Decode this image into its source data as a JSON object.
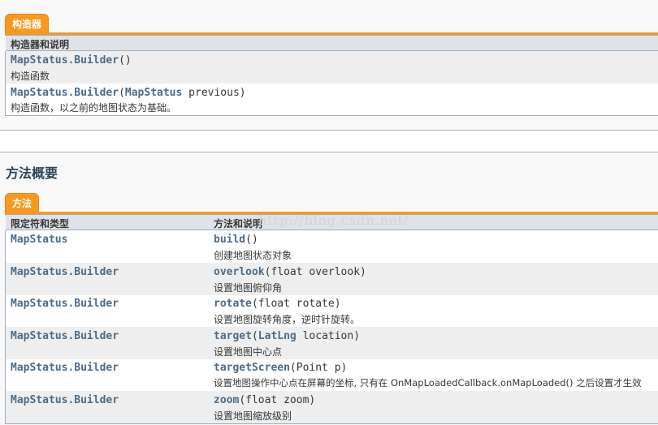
{
  "constructor_section": {
    "tab_label": "构造器",
    "header": "构造器和说明",
    "rows": [
      {
        "link": "MapStatus.Builder",
        "signature_rest": "()",
        "param_link": "",
        "param_rest": "",
        "description": "构造函数"
      },
      {
        "link": "MapStatus.Builder",
        "signature_rest": "(",
        "param_link": "MapStatus",
        "param_rest": " previous)",
        "description": "构造函数，以之前的地图状态为基础。"
      }
    ]
  },
  "method_section": {
    "heading": "方法概要",
    "tab_label": "方法",
    "header_type": "限定符和类型",
    "header_method": "方法和说明",
    "watermark": "http://blog.csdn.net/",
    "rows": [
      {
        "type": "MapStatus",
        "method": "build",
        "params": "()",
        "param_link": "",
        "param_rest": "",
        "description": "创建地图状态对象"
      },
      {
        "type": "MapStatus.Builder",
        "method": "overlook",
        "params": "(float overlook)",
        "param_link": "",
        "param_rest": "",
        "description": "设置地图俯仰角"
      },
      {
        "type": "MapStatus.Builder",
        "method": "rotate",
        "params": "(float rotate)",
        "param_link": "",
        "param_rest": "",
        "description": "设置地图旋转角度，逆时针旋转。"
      },
      {
        "type": "MapStatus.Builder",
        "method": "target",
        "params": "(",
        "param_link": "LatLng",
        "param_rest": " location)",
        "description": "设置地图中心点"
      },
      {
        "type": "MapStatus.Builder",
        "method": "targetScreen",
        "params": "(Point p)",
        "param_link": "",
        "param_rest": "",
        "description": "设置地图操作中心点在屏幕的坐标, 只有在 OnMapLoadedCallback.onMapLoaded() 之后设置才生效"
      },
      {
        "type": "MapStatus.Builder",
        "method": "zoom",
        "params": "(float zoom)",
        "param_link": "",
        "param_rest": "",
        "description": "设置地图缩放级别"
      }
    ]
  }
}
